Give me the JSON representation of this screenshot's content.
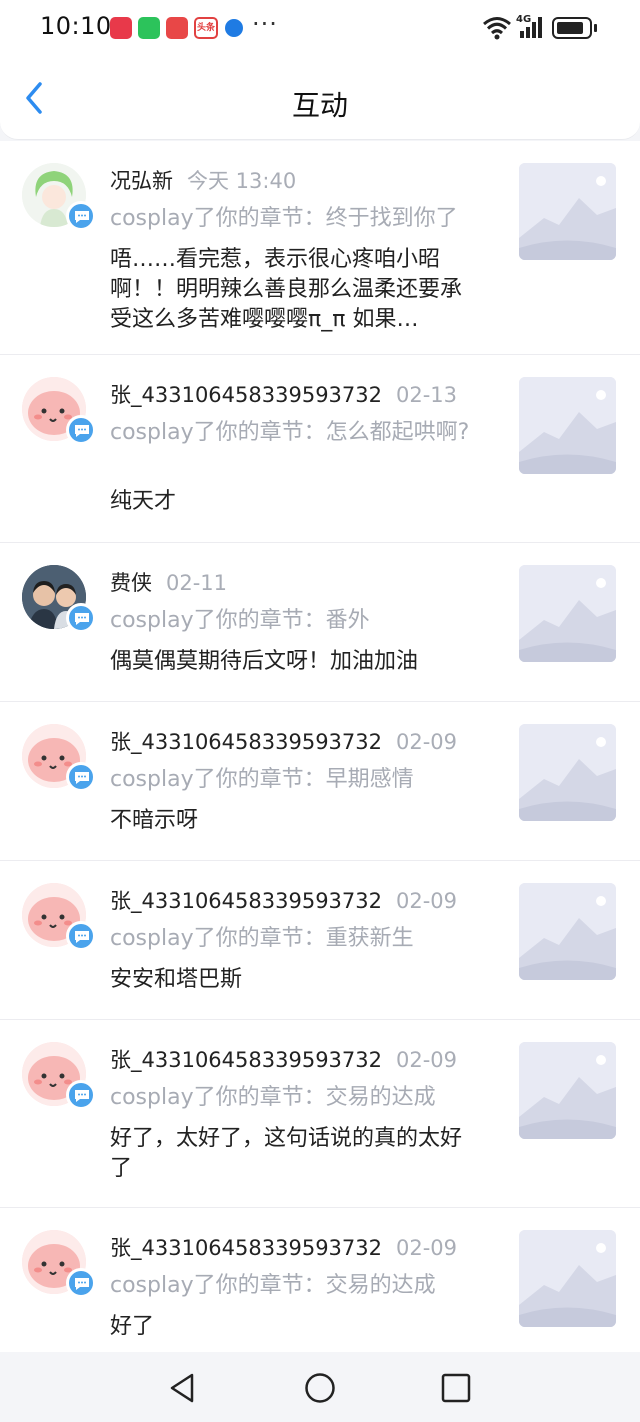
{
  "status_bar": {
    "time": "10:10",
    "notif_toutiao": "头条",
    "more": "···",
    "network": "4G"
  },
  "header": {
    "title": "互动"
  },
  "items": [
    {
      "name": "况弘新",
      "time": "今天 13:40",
      "chapter": "cosplay了你的章节：终于找到你了",
      "comment": "唔……看完惹，表示很心疼咱小昭啊！！明明辣么善良那么温柔还要承受这么多苦难嘤嘤嘤π_π 如果…",
      "avatar": "green-hair-avatar"
    },
    {
      "name": "张_433106458339593732",
      "time": "02-13",
      "chapter": "cosplay了你的章节：怎么都起哄啊?",
      "comment": "纯天才",
      "avatar": "pink-cartoon-avatar"
    },
    {
      "name": "费侠",
      "time": "02-11",
      "chapter": "cosplay了你的章节：番外",
      "comment": "偶莫偶莫期待后文呀！加油加油",
      "avatar": "photo-avatar"
    },
    {
      "name": "张_433106458339593732",
      "time": "02-09",
      "chapter": "cosplay了你的章节：早期感情",
      "comment": "不暗示呀",
      "avatar": "pink-cartoon-avatar"
    },
    {
      "name": "张_433106458339593732",
      "time": "02-09",
      "chapter": "cosplay了你的章节：重获新生",
      "comment": "安安和塔巴斯",
      "avatar": "pink-cartoon-avatar"
    },
    {
      "name": "张_433106458339593732",
      "time": "02-09",
      "chapter": "cosplay了你的章节：交易的达成",
      "comment": "好了，太好了，这句话说的真的太好了",
      "avatar": "pink-cartoon-avatar"
    },
    {
      "name": "张_433106458339593732",
      "time": "02-09",
      "chapter": "cosplay了你的章节：交易的达成",
      "comment": "好了",
      "avatar": "pink-cartoon-avatar"
    }
  ],
  "colors": {
    "accent": "#2d8cf0",
    "badge": "#4aa3ec",
    "secondary_text": "#a7abb4"
  },
  "nav": {
    "back": "back-triangle-icon",
    "home": "home-circle-icon",
    "recents": "recents-square-icon"
  }
}
